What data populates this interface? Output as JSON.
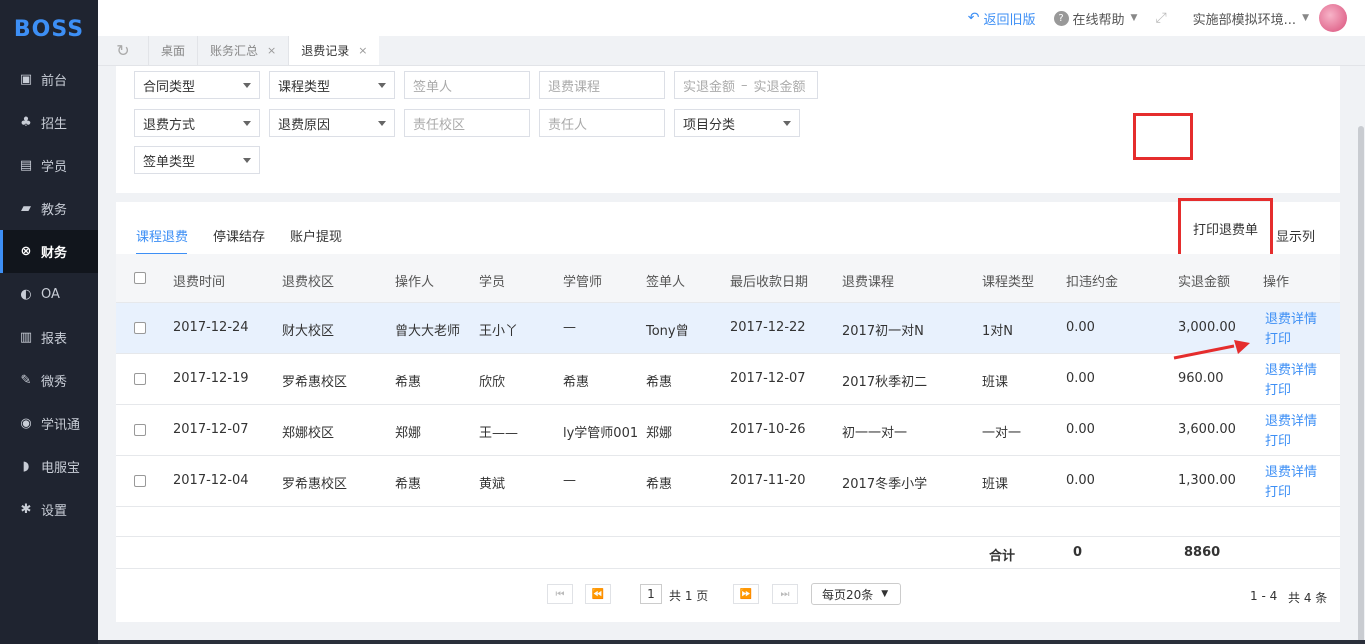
{
  "app": {
    "logo": "BOSS"
  },
  "sidebar": {
    "items": [
      {
        "label": "前台",
        "icon": "calendar-icon"
      },
      {
        "label": "招生",
        "icon": "user-plus-icon"
      },
      {
        "label": "学员",
        "icon": "id-card-icon"
      },
      {
        "label": "教务",
        "icon": "book-icon"
      },
      {
        "label": "财务",
        "icon": "money-icon",
        "active": true
      },
      {
        "label": "OA",
        "icon": "toggle-icon"
      },
      {
        "label": "报表",
        "icon": "bar-chart-icon"
      },
      {
        "label": "微秀",
        "icon": "show-icon"
      },
      {
        "label": "学讯通",
        "icon": "location-icon"
      },
      {
        "label": "电服宝",
        "icon": "phone-icon"
      },
      {
        "label": "设置",
        "icon": "gear-icon"
      }
    ]
  },
  "header": {
    "back_label": "返回旧版",
    "help_label": "在线帮助",
    "env_label": "实施部模拟环境..."
  },
  "tabs": [
    {
      "label": "桌面"
    },
    {
      "label": "账务汇总",
      "closable": true
    },
    {
      "label": "退费记录",
      "closable": true,
      "current": true
    }
  ],
  "filters": {
    "contract_type": "合同类型",
    "course_type": "课程类型",
    "signer_ph": "签单人",
    "refund_course_ph": "退费课程",
    "amount_from_ph": "实退金额",
    "amount_sep": "–",
    "amount_to_ph": "实退金额",
    "refund_method": "退费方式",
    "refund_reason": "退费原因",
    "resp_campus_ph": "责任校区",
    "resp_person_ph": "责任人",
    "item_category": "项目分类",
    "sign_type": "签单类型"
  },
  "panel": {
    "tabs": [
      "课程退费",
      "停课结存",
      "账户提现"
    ],
    "print_button": "打印退费单",
    "columns_button": "显示列"
  },
  "table": {
    "headers": [
      "退费时间",
      "退费校区",
      "操作人",
      "学员",
      "学管师",
      "签单人",
      "最后收款日期",
      "退费课程",
      "课程类型",
      "扣违约金",
      "实退金额",
      "操作"
    ],
    "rows": [
      {
        "date": "2017-12-24",
        "campus": "财大校区",
        "operator": "曾大大老师",
        "student": "王小丫",
        "manager": "—",
        "signer": "Tony曾",
        "last_pay": "2017-12-22",
        "course": "2017初一对N",
        "ctype": "1对N",
        "penalty": "0.00",
        "amount": "3,000.00",
        "detail": "退费详情",
        "print": "打印"
      },
      {
        "date": "2017-12-19",
        "campus": "罗希惠校区",
        "operator": "希惠",
        "student": "欣欣",
        "manager": "希惠",
        "signer": "希惠",
        "last_pay": "2017-12-07",
        "course": "2017秋季初二",
        "ctype": "班课",
        "penalty": "0.00",
        "amount": "960.00",
        "detail": "退费详情",
        "print": "打印"
      },
      {
        "date": "2017-12-07",
        "campus": "郑娜校区",
        "operator": "郑娜",
        "student": "王——",
        "manager": "ly学管师001",
        "signer": "郑娜",
        "last_pay": "2017-10-26",
        "course": "初一一对一",
        "ctype": "一对一",
        "penalty": "0.00",
        "amount": "3,600.00",
        "detail": "退费详情",
        "print": "打印"
      },
      {
        "date": "2017-12-04",
        "campus": "罗希惠校区",
        "operator": "希惠",
        "student": "黄斌",
        "manager": "—",
        "signer": "希惠",
        "last_pay": "2017-11-20",
        "course": "2017冬季小学",
        "ctype": "班课",
        "penalty": "0.00",
        "amount": "1,300.00",
        "detail": "退费详情",
        "print": "打印"
      }
    ],
    "total_label": "合计",
    "total_penalty": "0",
    "total_amount": "8860"
  },
  "pagination": {
    "page": "1",
    "total_pages_text": "共 1 页",
    "per_page": "每页20条",
    "range_text": "1 - 4",
    "total_text": "共 4 条"
  },
  "colors": {
    "accent": "#3d8ff5",
    "sidebar_bg": "#1f2430",
    "highlight": "#e52d2d"
  }
}
